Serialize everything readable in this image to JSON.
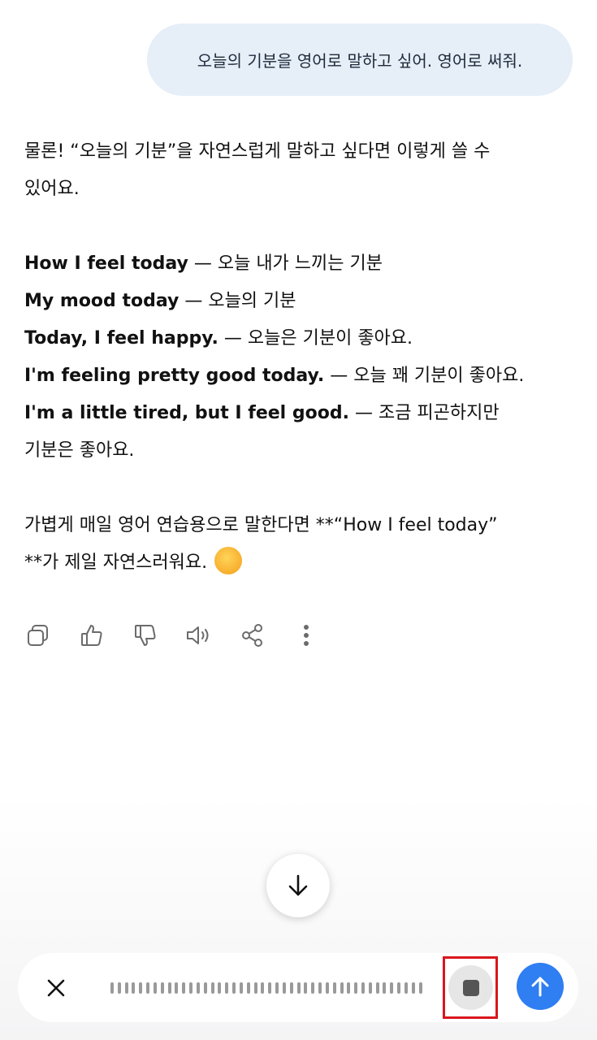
{
  "user_message": "오늘의 기분을 영어로 말하고 싶어. 영어로 써줘.",
  "answer": {
    "intro_line1": "물론! “오늘의 기분”을 자연스럽게 말하고 싶다면 이렇게 쓸 수",
    "intro_line2": "있어요.",
    "examples": [
      {
        "en": "How I feel today",
        "ko": " — 오늘 내가 느끼는 기분"
      },
      {
        "en": "My mood today",
        "ko": " — 오늘의 기분"
      },
      {
        "en": "Today, I feel happy.",
        "ko": " — 오늘은 기분이 좋아요."
      },
      {
        "en": "I'm feeling pretty good today.",
        "ko": " — 오늘 꽤 기분이 좋아요."
      },
      {
        "en": "I'm a little tired, but I feel good.",
        "ko": " — 조금 피곤하지만",
        "ko_cont": "기분은 좋아요."
      }
    ],
    "closing_line1": "가볍게 매일 영어 연습용으로 말한다면 **“How I feel today”",
    "closing_line2": "**가 제일 자연스러워요.",
    "emoji": "smiling-face-emoji"
  },
  "actions": {
    "icons": [
      "copy-icon",
      "thumbs-up-icon",
      "thumbs-down-icon",
      "speaker-icon",
      "share-icon",
      "more-vertical-icon"
    ]
  },
  "scroll_down": {
    "icon": "arrow-down-icon"
  },
  "input_bar": {
    "close_icon": "close-icon",
    "waveform_icon": "waveform-icon",
    "stop_icon": "stop-icon",
    "send_icon": "arrow-up-icon",
    "colors": {
      "send": "#2f7ef2",
      "stop_bg": "#e6e6e6",
      "highlight": "#d9161c",
      "user_bubble": "#e6eef8"
    }
  }
}
